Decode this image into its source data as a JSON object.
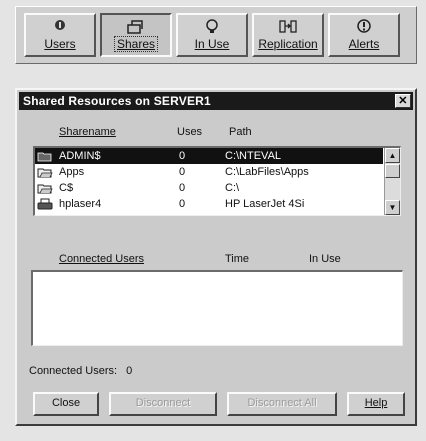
{
  "toolbar": {
    "buttons": [
      {
        "label": "Users",
        "icon": "users-icon",
        "pressed": false
      },
      {
        "label": "Shares",
        "icon": "shares-icon",
        "pressed": true
      },
      {
        "label": "In Use",
        "icon": "in-use-icon",
        "pressed": false
      },
      {
        "label": "Replication",
        "icon": "replication-icon",
        "pressed": false
      },
      {
        "label": "Alerts",
        "icon": "alerts-icon",
        "pressed": false
      }
    ]
  },
  "dialog": {
    "title": "Shared Resources on SERVER1",
    "close_glyph": "✕",
    "shares_columns": {
      "sharename": "Sharename",
      "uses": "Uses",
      "path": "Path"
    },
    "shares": [
      {
        "icon": "shared-folder-icon",
        "name": "ADMIN$",
        "uses": "0",
        "path": "C:\\NTEVAL",
        "selected": true
      },
      {
        "icon": "shared-folder-icon",
        "name": "Apps",
        "uses": "0",
        "path": "C:\\LabFiles\\Apps",
        "selected": false
      },
      {
        "icon": "shared-folder-icon",
        "name": "C$",
        "uses": "0",
        "path": "C:\\",
        "selected": false
      },
      {
        "icon": "printer-icon",
        "name": "hplaser4",
        "uses": "0",
        "path": "HP LaserJet 4Si",
        "selected": false
      }
    ],
    "users_columns": {
      "connected_users": "Connected Users",
      "time": "Time",
      "in_use": "In Use"
    },
    "connected_users_label": "Connected Users:",
    "connected_users_count": "0",
    "buttons": {
      "close": "Close",
      "disconnect": "Disconnect",
      "disconnect_all": "Disconnect All",
      "help": "Help"
    },
    "colors": {
      "selection": "#111111",
      "titlebar": "#1a1a1a"
    }
  }
}
